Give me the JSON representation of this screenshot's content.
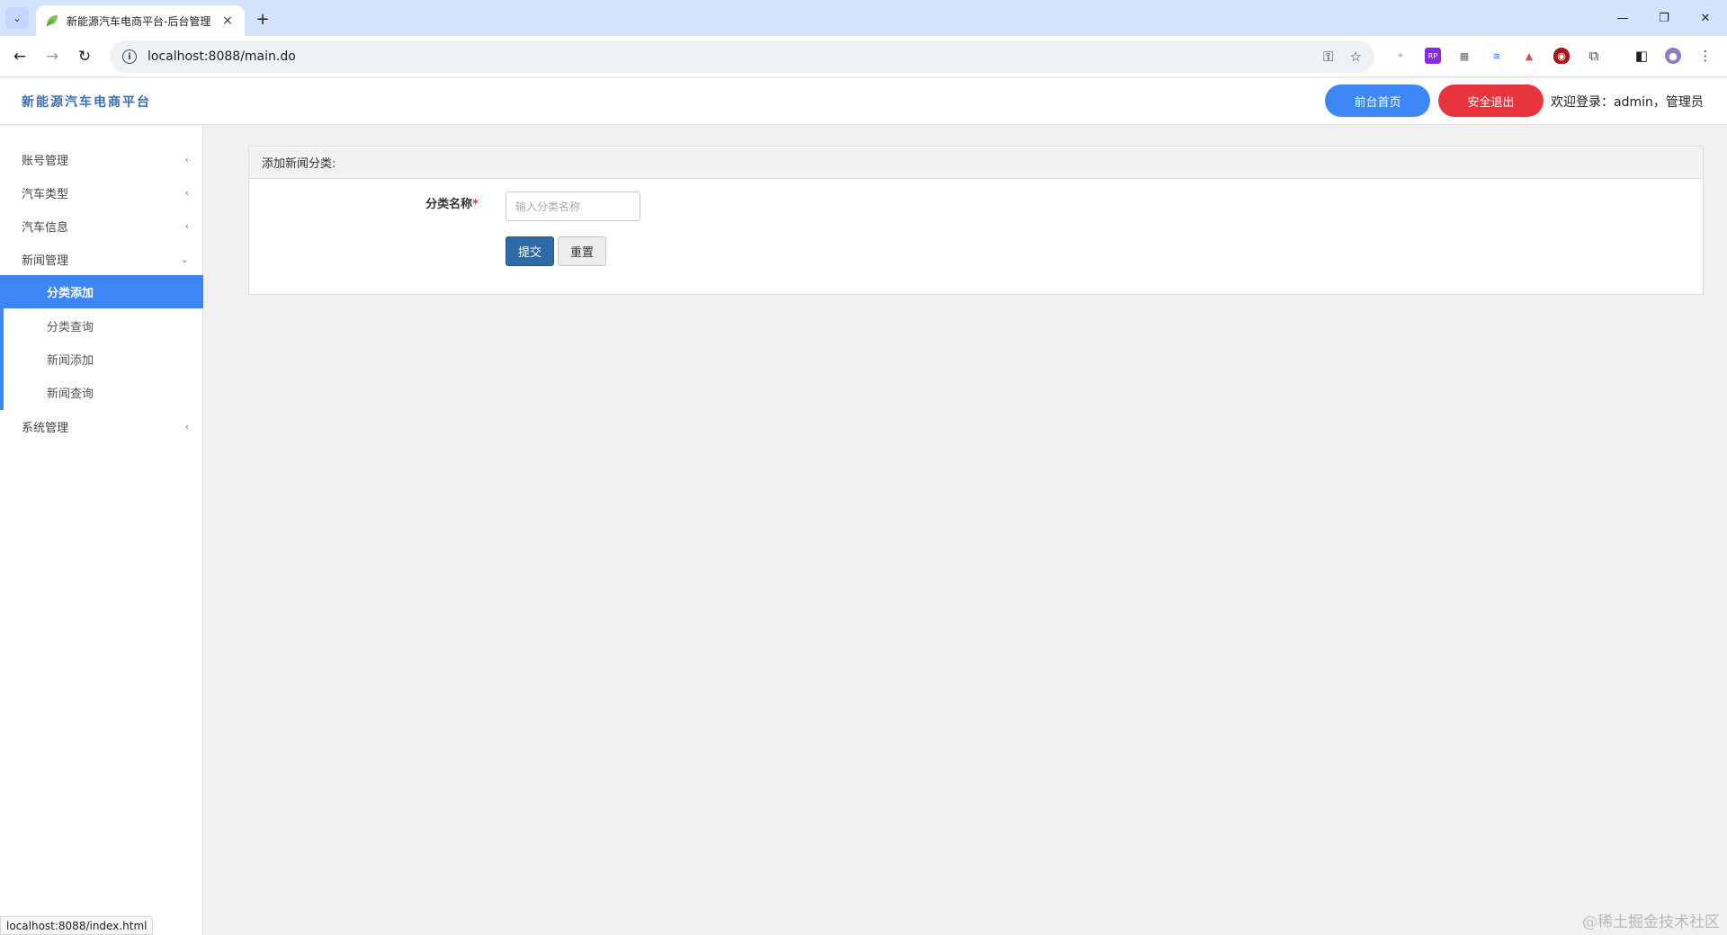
{
  "browser": {
    "tab_title": "新能源汽车电商平台-后台管理",
    "tab_close": "×",
    "new_tab": "+",
    "tab_list": "⌄",
    "url": "localhost:8088/main.do",
    "minimize": "—",
    "restore": "❐",
    "close": "✕"
  },
  "header": {
    "brand": "新能源汽车电商平台",
    "home_button": "前台首页",
    "logout_button": "安全退出",
    "welcome": "欢迎登录：admin，管理员"
  },
  "sidebar": {
    "items": [
      {
        "label": "账号管理"
      },
      {
        "label": "汽车类型"
      },
      {
        "label": "汽车信息"
      },
      {
        "label": "新闻管理"
      },
      {
        "label": "系统管理"
      }
    ],
    "sub_items": [
      {
        "label": "分类添加"
      },
      {
        "label": "分类查询"
      },
      {
        "label": "新闻添加"
      },
      {
        "label": "新闻查询"
      }
    ]
  },
  "form": {
    "title": "添加新闻分类:",
    "name_label": "分类名称",
    "required_mark": "*",
    "name_placeholder": "输入分类名称",
    "name_value": "",
    "submit": "提交",
    "reset": "重置"
  },
  "status_url": "localhost:8088/index.html",
  "watermark": "@稀土掘金技术社区",
  "colors": {
    "accent": "#3d86f5",
    "danger": "#e8343c",
    "submit": "#2c6aa8"
  }
}
